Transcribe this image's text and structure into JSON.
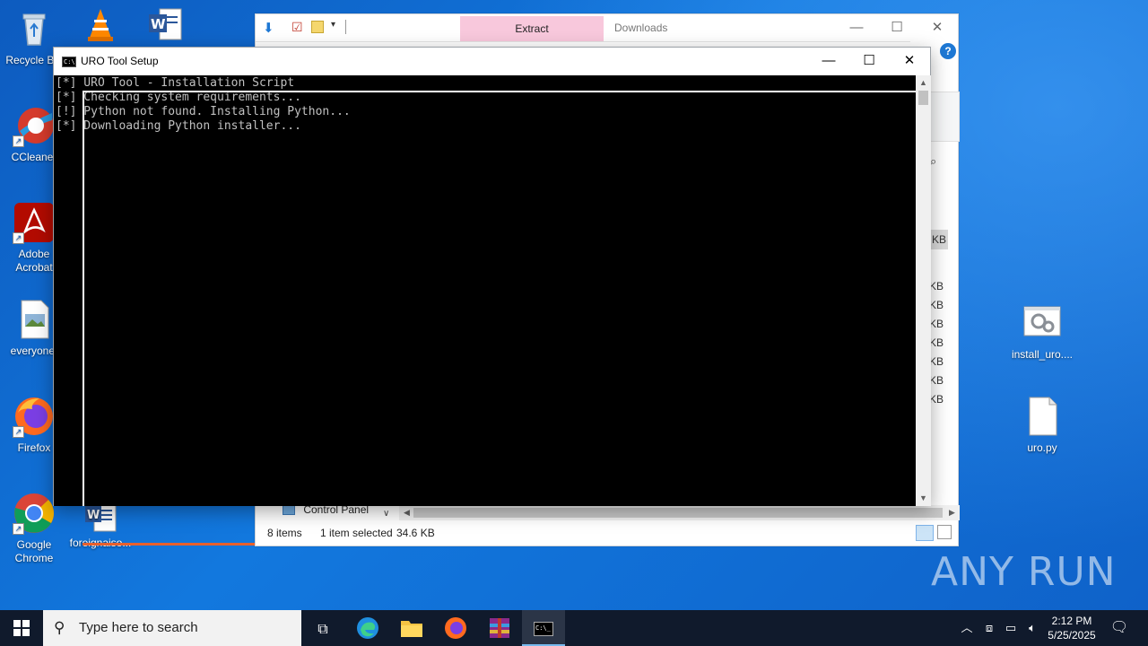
{
  "desktop": {
    "icons_left": [
      {
        "label": "Recycle Bin",
        "icon": "recycle-bin-icon"
      },
      {
        "label": "CCleaner",
        "icon": "ccleaner-icon"
      },
      {
        "label": "Adobe Acrobat",
        "icon": "acrobat-icon"
      },
      {
        "label": "everyone.",
        "icon": "image-file-icon"
      },
      {
        "label": "Firefox",
        "icon": "firefox-icon"
      },
      {
        "label": "Google Chrome",
        "icon": "chrome-icon"
      }
    ],
    "icon_word_doc": {
      "label": "foreignaiso...",
      "icon": "word-doc-icon"
    },
    "icons_right": [
      {
        "label": "install_uro....",
        "icon": "batch-settings-icon"
      },
      {
        "label": "uro.py",
        "icon": "blank-file-icon"
      }
    ]
  },
  "explorer": {
    "ribbon_tab": "Extract",
    "window_title": "Downloads",
    "nav_item": "Control Panel",
    "status": {
      "items": "8 items",
      "selected": "1 item selected",
      "size": "34.6 KB"
    },
    "size_unit": "KB"
  },
  "console": {
    "title": "URO Tool Setup",
    "lines": [
      "[*] URO Tool - Installation Script",
      "[*] Checking system requirements...",
      "[!] Python not found. Installing Python...",
      "[*] Downloading Python installer..."
    ]
  },
  "taskbar": {
    "search_placeholder": "Type here to search",
    "time": "2:12 PM",
    "date": "5/25/2025"
  },
  "watermark": "ANY RUN",
  "colors": {
    "desktop_blue": "#1278de",
    "taskbar": "#101a2c",
    "ribbon_highlight": "#f8c8dc",
    "console_bg": "#000000",
    "console_text": "#c0c0c0"
  }
}
